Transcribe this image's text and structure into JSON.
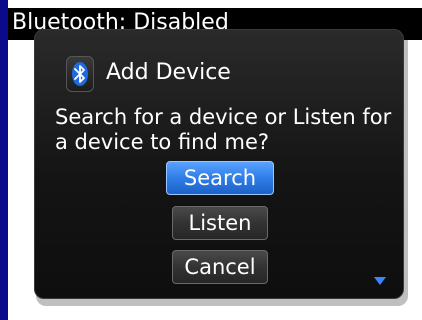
{
  "status_bar": {
    "title": "Bluetooth: Disabled"
  },
  "dialog": {
    "icon": "bluetooth-icon",
    "title": "Add Device",
    "message": "Search for a device or Listen for a device to find me?",
    "buttons": {
      "search": "Search",
      "listen": "Listen",
      "cancel": "Cancel"
    },
    "scroll_indicator": "scroll-down-arrow-icon"
  },
  "colors": {
    "accent_blue": "#2f7de6",
    "dialog_bg": "#141414",
    "title_bar_bg": "#000000"
  }
}
